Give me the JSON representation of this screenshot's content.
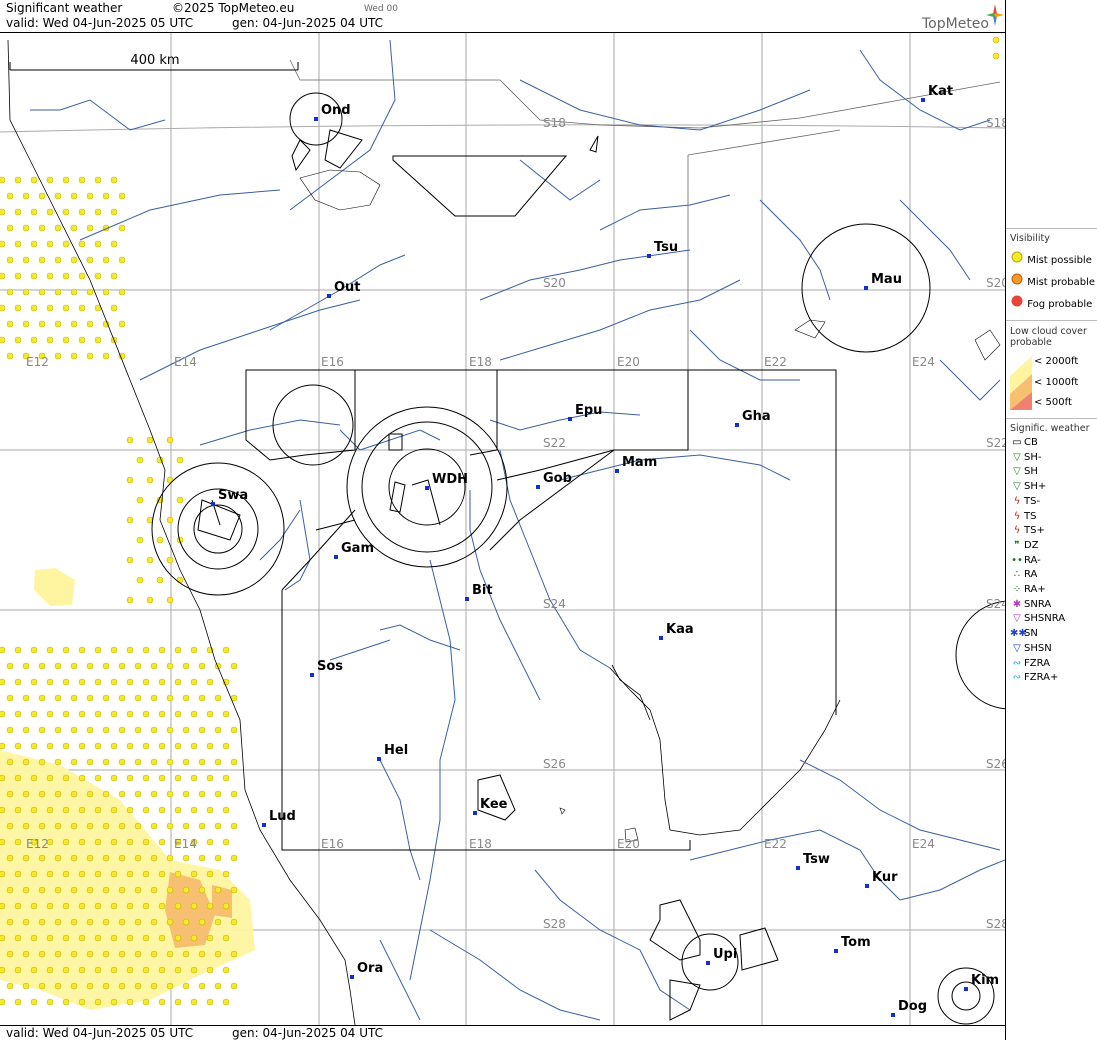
{
  "header": {
    "title": "Significant weather",
    "copyright": "©2025 TopMeteo.eu",
    "run": "Wed 00",
    "valid": "valid:  Wed  04-Jun-2025  05 UTC",
    "gen": "gen: 04-Jun-2025 04 UTC",
    "logo": "TopMeteo"
  },
  "footer": {
    "valid": "valid:  Wed  04-Jun-2025  05 UTC",
    "gen": "gen: 04-Jun-2025 04 UTC"
  },
  "map": {
    "scale_label": "400 km",
    "lon_labels": [
      "E12",
      "E14",
      "E16",
      "E18",
      "E20",
      "E22",
      "E24"
    ],
    "lat_labels": [
      "S18",
      "S20",
      "S22",
      "S24",
      "S26",
      "S28"
    ],
    "cities": [
      {
        "id": "ond",
        "name": "Ond"
      },
      {
        "id": "kat",
        "name": "Kat"
      },
      {
        "id": "tsu",
        "name": "Tsu"
      },
      {
        "id": "out",
        "name": "Out"
      },
      {
        "id": "mau",
        "name": "Mau"
      },
      {
        "id": "epu",
        "name": "Epu"
      },
      {
        "id": "gha",
        "name": "Gha"
      },
      {
        "id": "mam",
        "name": "Mam"
      },
      {
        "id": "wdh",
        "name": "WDH"
      },
      {
        "id": "gob",
        "name": "Gob"
      },
      {
        "id": "swa",
        "name": "Swa"
      },
      {
        "id": "gam",
        "name": "Gam"
      },
      {
        "id": "bit",
        "name": "Bit"
      },
      {
        "id": "kaa",
        "name": "Kaa"
      },
      {
        "id": "sos",
        "name": "Sos"
      },
      {
        "id": "hel",
        "name": "Hel"
      },
      {
        "id": "kee",
        "name": "Kee"
      },
      {
        "id": "lud",
        "name": "Lud"
      },
      {
        "id": "tsw",
        "name": "Tsw"
      },
      {
        "id": "kur",
        "name": "Kur"
      },
      {
        "id": "tom",
        "name": "Tom"
      },
      {
        "id": "upi",
        "name": "Upi"
      },
      {
        "id": "ora",
        "name": "Ora"
      },
      {
        "id": "kim",
        "name": "Kim"
      },
      {
        "id": "dog",
        "name": "Dog"
      }
    ]
  },
  "legend": {
    "visibility_title": "Visibility",
    "mist_possible": "Mist possible",
    "mist_probable": "Mist probable",
    "fog_probable": "Fog probable",
    "cloud_title": "Low cloud cover probable",
    "cloud_2000": "< 2000ft",
    "cloud_1000": "< 1000ft",
    "cloud_500": "<   500ft",
    "weather_title": "Signific. weather",
    "items": [
      "CB",
      "SH-",
      "SH",
      "SH+",
      "TS-",
      "TS",
      "TS+",
      "DZ",
      "RA-",
      "RA",
      "RA+",
      "SNRA",
      "SHSNRA",
      "SN",
      "SHSN",
      "FZRA",
      "FZRA+"
    ],
    "colors": {
      "mist_possible": "#f5e92a",
      "mist_probable": "#f59a2a",
      "fog_probable": "#e8443a",
      "cloud_2000": "#fff5a0",
      "cloud_1000": "#f7c070",
      "cloud_500": "#f08070"
    }
  }
}
